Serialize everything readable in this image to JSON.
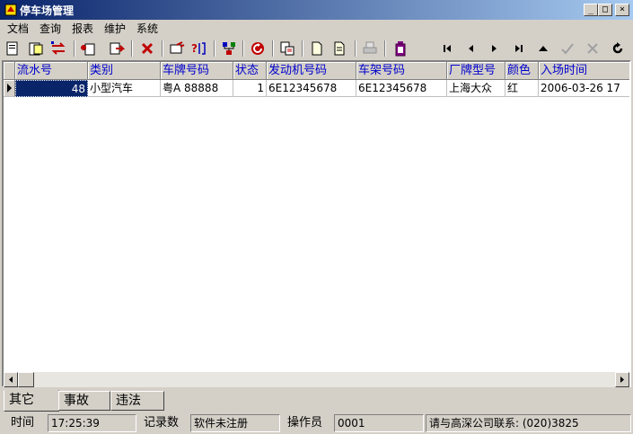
{
  "window": {
    "title": "停车场管理",
    "minimize_glyph": "_",
    "maximize_glyph": "□",
    "close_glyph": "×"
  },
  "menu": [
    "文档",
    "查询",
    "报表",
    "维护",
    "系统"
  ],
  "toolbar_icons": [
    "new-icon",
    "open-icon",
    "switch-icon",
    "add-icon",
    "export-icon",
    "delete-icon",
    "search-icon",
    "help-icon",
    "tree-icon",
    "refresh-icon",
    "print-icon",
    "page-icon",
    "page-copy-icon",
    "printer-icon",
    "battery-icon",
    "first-record-icon",
    "prev-record-icon",
    "next-record-icon",
    "last-record-icon",
    "insert-icon",
    "post-icon",
    "cancel-icon",
    "reload-icon"
  ],
  "grid": {
    "columns": [
      "流水号",
      "类别",
      "车牌号码",
      "状态",
      "发动机号码",
      "车架号码",
      "厂牌型号",
      "颜色",
      "入场时间"
    ],
    "rows": [
      [
        "48",
        "小型汽车",
        "粤A 88888",
        "1",
        "6E12345678",
        "6E12345678",
        "上海大众",
        "红",
        "2006-03-26 17"
      ]
    ]
  },
  "tabs": [
    "其它",
    "事故",
    "违法"
  ],
  "status": {
    "time_label": "时间",
    "time_value": "17:25:39",
    "records_label": "记录数",
    "records_value": "软件未注册",
    "operator_label": "操作员",
    "operator_value": "0001",
    "contact": "请与高深公司联系: (020)3825"
  }
}
